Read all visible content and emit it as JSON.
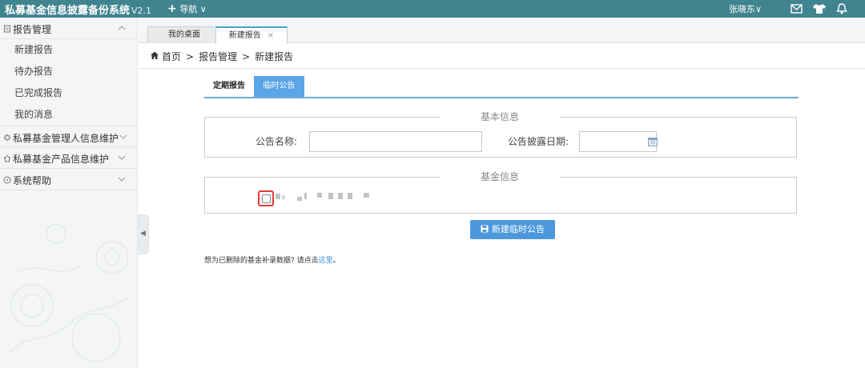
{
  "app": {
    "title": "私募基金信息披露备份系统",
    "version": "V2.1",
    "nav_label": "导航",
    "nav_plus": "+",
    "nav_chevron": "∨"
  },
  "topbar": {
    "user_name": "张晓东",
    "user_chevron": "∨",
    "icons": [
      "mail-icon",
      "shirt-icon",
      "bell-icon"
    ]
  },
  "sidebar": {
    "groups": [
      {
        "label": "报告管理",
        "icon": "report-icon",
        "expanded": true,
        "items": [
          "新建报告",
          "待办报告",
          "已完成报告",
          "我的消息"
        ]
      },
      {
        "label": "私募基金管理人信息维护",
        "icon": "gear-icon"
      },
      {
        "label": "私募基金产品信息维护",
        "icon": "home-icon"
      },
      {
        "label": "系统帮助",
        "icon": "help-icon"
      }
    ],
    "collapse_arrow": "◀"
  },
  "page_tabs": [
    {
      "label": "我的桌面",
      "active": false
    },
    {
      "label": "新建报告",
      "active": true,
      "close": "×"
    }
  ],
  "breadcrumb": {
    "home": "首页",
    "sep": ">",
    "section": "报告管理",
    "current": "新建报告"
  },
  "report_tabs": [
    {
      "label": "定期报告",
      "active": false
    },
    {
      "label": "临时公告",
      "active": true
    }
  ],
  "basic_info": {
    "legend": "基本信息",
    "name_label": "公告名称:",
    "name_value": "",
    "date_label": "公告披露日期:",
    "date_value": ""
  },
  "fund_info": {
    "legend": "基金信息",
    "checked": false
  },
  "create_button": {
    "label": "新建临时公告"
  },
  "footer_note": {
    "text": "想为已删除的基金补录数据? 请点击",
    "link": "这里",
    "end": "。"
  },
  "colors": {
    "topbar": "#40848f",
    "accent": "#5aa5e6",
    "button": "#4d98dc",
    "highlight": "#e03b3b"
  }
}
